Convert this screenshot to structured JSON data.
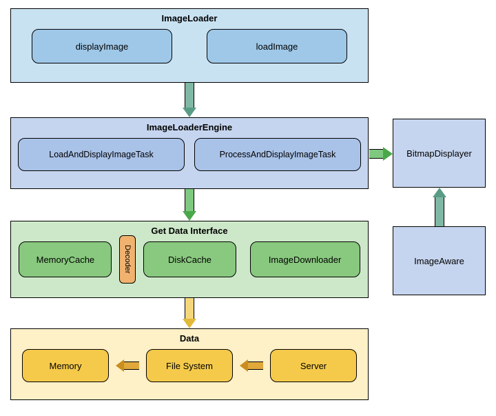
{
  "imageLoader": {
    "title": "ImageLoader",
    "items": [
      "displayImage",
      "loadImage"
    ]
  },
  "engine": {
    "title": "ImageLoaderEngine",
    "items": [
      "LoadAndDisplayImageTask",
      "ProcessAndDisplayImageTask"
    ]
  },
  "getData": {
    "title": "Get Data Interface",
    "memoryCache": "MemoryCache",
    "decoder": "Decoder",
    "diskCache": "DiskCache",
    "downloader": "ImageDownloader"
  },
  "data": {
    "title": "Data",
    "memory": "Memory",
    "fileSystem": "File System",
    "server": "Server"
  },
  "bitmapDisplayer": "BitmapDisplayer",
  "imageAware": "ImageAware"
}
